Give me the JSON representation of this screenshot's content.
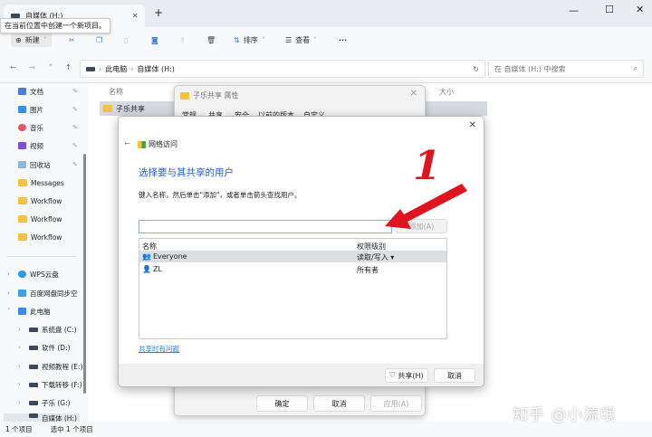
{
  "window": {
    "tab_title": "自媒体 (H:)",
    "tooltip": "在当前位置中创建一个新项目。"
  },
  "toolbar": {
    "new": "新建",
    "sort": "排序",
    "view": "查看",
    "more": "···"
  },
  "address": {
    "path": [
      "此电脑",
      "自媒体 (H:)"
    ],
    "search_placeholder": "在 自媒体 (H:) 中搜索"
  },
  "sidebar": {
    "quick": [
      {
        "label": "文档",
        "color": "#4a7fd4"
      },
      {
        "label": "图片",
        "color": "#3a8ee6"
      },
      {
        "label": "音乐",
        "color": "#e8536b"
      },
      {
        "label": "视频",
        "color": "#7b4fd6"
      },
      {
        "label": "回收站",
        "color": "#8fb8d8"
      },
      {
        "label": "Messages",
        "color": "#f5c242"
      },
      {
        "label": "Workflow",
        "color": "#f5c242"
      },
      {
        "label": "Workflow",
        "color": "#f5c242"
      },
      {
        "label": "Workflow",
        "color": "#f5c242"
      }
    ],
    "other": [
      {
        "label": "WPS云盘"
      },
      {
        "label": "百度网盘同步空"
      },
      {
        "label": "此电脑"
      }
    ],
    "drives": [
      "系统盘 (C:)",
      "软件 (D:)",
      "视频教程 (E:)",
      "下载转移 (F:)",
      "子乐 (G:)",
      "自媒体 (H:)"
    ]
  },
  "filelist": {
    "col_name": "名称",
    "col_size": "大小",
    "rows": [
      "子乐共享"
    ]
  },
  "status": {
    "count": "1 个项目",
    "selected": "选中 1 个项目"
  },
  "properties": {
    "title": "子乐共享 属性",
    "tabs": [
      "常规",
      "共享",
      "安全",
      "以前的版本",
      "自定义"
    ],
    "ok": "确定",
    "cancel": "取消",
    "apply": "应用(A)"
  },
  "network": {
    "breadcrumb": "网络访问",
    "heading": "选择要与其共享的用户",
    "instruction": "键入名称，然后单击\"添加\"，或者单击箭头查找用户。",
    "input_value": "",
    "add": "添加(A)",
    "col_name": "名称",
    "col_perm": "权限级别",
    "users": [
      {
        "name": "Everyone",
        "perm": "读取/写入 ▾"
      },
      {
        "name": "ZL",
        "perm": "所有者"
      }
    ],
    "help_link": "共享时有问题",
    "share": "共享(H)",
    "cancel": "取消"
  },
  "annotation": {
    "number": "1",
    "color": "#e0141e"
  },
  "watermark": "知乎 @小流氓"
}
